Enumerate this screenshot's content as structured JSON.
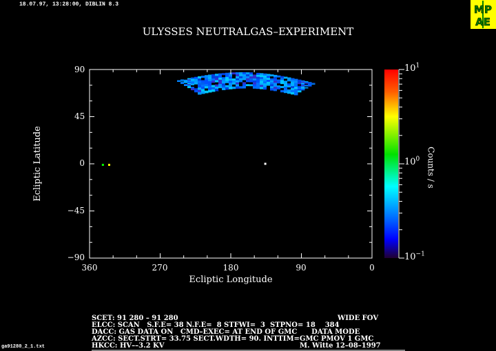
{
  "header": {
    "timestamp": "18.07.97, 13:28:00, DIBLIN 8.3",
    "logo": "MPAE"
  },
  "chart_data": {
    "type": "heatmap",
    "title": "ULYSSES NEUTRALGAS–EXPERIMENT",
    "xlabel": "Ecliptic Longitude",
    "ylabel": "Ecliptic Latitude",
    "xlim": [
      360,
      0
    ],
    "ylim": [
      -90,
      90
    ],
    "xticks": [
      "360",
      "270",
      "180",
      "90",
      "0"
    ],
    "yticks": [
      "90",
      "45",
      "0",
      "−45",
      "−90"
    ],
    "colorbar": {
      "label": "Counts / s",
      "scale": "log",
      "range": [
        0.1,
        10
      ],
      "ticks": [
        {
          "base": "10",
          "exp": "1"
        },
        {
          "base": "10",
          "exp": "0"
        },
        {
          "base": "10",
          "exp": "−1"
        }
      ]
    },
    "band": {
      "lon_range": [
        35,
        255
      ],
      "lat_range": [
        60,
        80
      ],
      "typical_counts": 0.3
    },
    "points": [
      {
        "lon": 343,
        "lat": -1,
        "color": "#00ff00"
      },
      {
        "lon": 335,
        "lat": -1,
        "color": "#ffff00"
      },
      {
        "lon": 136,
        "lat": 0,
        "color": "#ffffff"
      }
    ]
  },
  "footer": {
    "lines": [
      "SCET: 91 280 – 91 280",
      "ELCC: SCAN   S.F.E= 38 N.F.E=  8 STFWI=  3  STPNO= 18    384",
      "DACC: GAS DATA ON   CMD–EXEC= AT END OF GMC      DATA MODE",
      "AZCC: SECT.STRT= 33.75 SECT.WDTH= 90. INTTIM=GMC PMOV 1 GMC",
      "HKCC: HV––3.2 KV"
    ],
    "wide_fov": "WIDE FOV",
    "author": "M. Witte 12–08–1997",
    "filename": "ga91280_2_1.txt"
  }
}
